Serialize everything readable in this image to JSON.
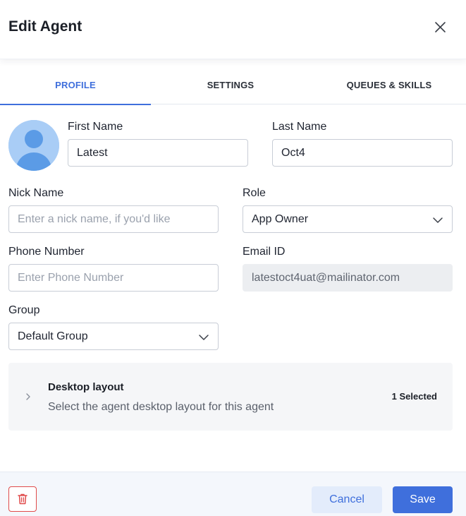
{
  "header": {
    "title": "Edit Agent",
    "close_icon": "close-icon"
  },
  "tabs": [
    {
      "label": "PROFILE",
      "active": true
    },
    {
      "label": "SETTINGS",
      "active": false
    },
    {
      "label": "QUEUES & SKILLS",
      "active": false
    }
  ],
  "avatar": {
    "icon": "user-avatar-icon",
    "color": "#a9cdf6"
  },
  "form": {
    "first_name": {
      "label": "First Name",
      "value": "Latest"
    },
    "last_name": {
      "label": "Last Name",
      "value": "Oct4"
    },
    "nick_name": {
      "label": "Nick Name",
      "value": "",
      "placeholder": "Enter a nick name, if you'd like"
    },
    "role": {
      "label": "Role",
      "value": "App Owner"
    },
    "phone": {
      "label": "Phone Number",
      "value": "",
      "placeholder": "Enter Phone Number"
    },
    "email": {
      "label": "Email ID",
      "value": "latestoct4uat@mailinator.com"
    },
    "group": {
      "label": "Group",
      "value": "Default Group"
    }
  },
  "desktop_layout": {
    "title": "Desktop layout",
    "description": "Select the agent desktop layout for this agent",
    "selected": "1 Selected"
  },
  "footer": {
    "cancel_label": "Cancel",
    "save_label": "Save",
    "delete_icon": "trash-icon"
  },
  "colors": {
    "accent": "#3f6fdc",
    "danger": "#e04b4b",
    "panel_bg": "#f5f6f8",
    "footer_bg": "#f4f7fc"
  }
}
